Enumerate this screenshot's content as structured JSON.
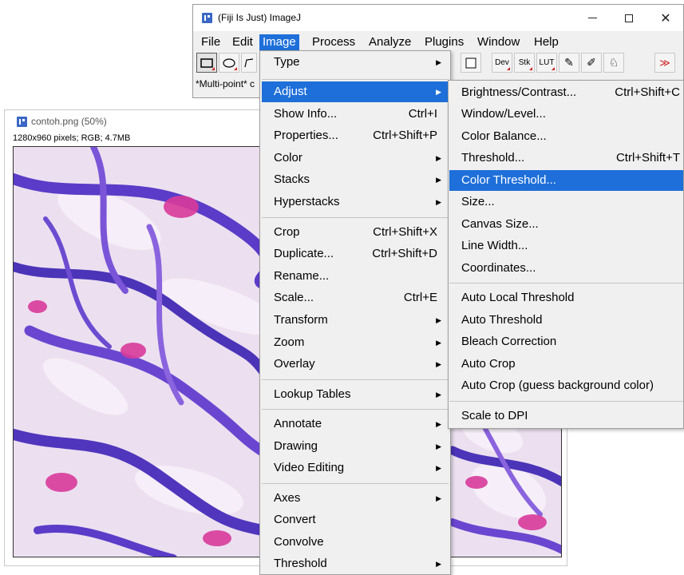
{
  "ij_window": {
    "title": "(Fiji Is Just) ImageJ",
    "controls": {
      "minimize": "minimize-icon",
      "maximize": "maximize-icon",
      "close": "✕"
    },
    "menubar": [
      "File",
      "Edit",
      "Image",
      "Process",
      "Analyze",
      "Plugins",
      "Window",
      "Help"
    ],
    "active_menu": "Image",
    "toolbar": [
      {
        "name": "rectangle-tool-icon",
        "label": ""
      },
      {
        "name": "oval-tool-icon",
        "label": ""
      },
      {
        "name": "polygon-tool-icon",
        "label": ""
      },
      {
        "name": "color-picker-tool-icon",
        "label": ""
      },
      {
        "name": "dev-tool-icon",
        "label": "Dev"
      },
      {
        "name": "stk-tool-icon",
        "label": "Stk"
      },
      {
        "name": "lut-tool-icon",
        "label": "LUT"
      },
      {
        "name": "pencil-tool-icon",
        "label": "✎"
      },
      {
        "name": "brush-tool-icon",
        "label": "✐"
      },
      {
        "name": "flood-fill-tool-icon",
        "label": "♘"
      },
      {
        "name": "more-tools-icon",
        "label": "≫"
      }
    ],
    "status": "*Multi-point* c"
  },
  "image_window": {
    "title": "contoh.png (50%)",
    "info": "1280x960 pixels; RGB; 4.7MB"
  },
  "image_menu": {
    "items": [
      {
        "label": "Type",
        "shortcut": "",
        "submenu": true
      },
      {
        "label": "Adjust",
        "shortcut": "",
        "submenu": true,
        "highlighted": true
      },
      {
        "label": "Show Info...",
        "shortcut": "Ctrl+I"
      },
      {
        "label": "Properties...",
        "shortcut": "Ctrl+Shift+P"
      },
      {
        "label": "Color",
        "shortcut": "",
        "submenu": true
      },
      {
        "label": "Stacks",
        "shortcut": "",
        "submenu": true
      },
      {
        "label": "Hyperstacks",
        "shortcut": "",
        "submenu": true
      },
      {
        "label": "Crop",
        "shortcut": "Ctrl+Shift+X"
      },
      {
        "label": "Duplicate...",
        "shortcut": "Ctrl+Shift+D"
      },
      {
        "label": "Rename...",
        "shortcut": ""
      },
      {
        "label": "Scale...",
        "shortcut": "Ctrl+E"
      },
      {
        "label": "Transform",
        "shortcut": "",
        "submenu": true
      },
      {
        "label": "Zoom",
        "shortcut": "",
        "submenu": true
      },
      {
        "label": "Overlay",
        "shortcut": "",
        "submenu": true
      },
      {
        "label": "Lookup Tables",
        "shortcut": "",
        "submenu": true
      },
      {
        "label": "Annotate",
        "shortcut": "",
        "submenu": true
      },
      {
        "label": "Drawing",
        "shortcut": "",
        "submenu": true
      },
      {
        "label": "Video Editing",
        "shortcut": "",
        "submenu": true
      },
      {
        "label": "Axes",
        "shortcut": "",
        "submenu": true
      },
      {
        "label": "Convert",
        "shortcut": ""
      },
      {
        "label": "Convolve",
        "shortcut": ""
      },
      {
        "label": "Threshold",
        "shortcut": "",
        "submenu": true
      }
    ]
  },
  "adjust_menu": {
    "items": [
      {
        "label": "Brightness/Contrast...",
        "shortcut": "Ctrl+Shift+C"
      },
      {
        "label": "Window/Level...",
        "shortcut": ""
      },
      {
        "label": "Color Balance...",
        "shortcut": ""
      },
      {
        "label": "Threshold...",
        "shortcut": "Ctrl+Shift+T"
      },
      {
        "label": "Color Threshold...",
        "shortcut": "",
        "highlighted": true
      },
      {
        "label": "Size...",
        "shortcut": ""
      },
      {
        "label": "Canvas Size...",
        "shortcut": ""
      },
      {
        "label": "Line Width...",
        "shortcut": ""
      },
      {
        "label": "Coordinates...",
        "shortcut": ""
      },
      {
        "label": "Auto Local Threshold",
        "shortcut": ""
      },
      {
        "label": "Auto Threshold",
        "shortcut": ""
      },
      {
        "label": "Bleach Correction",
        "shortcut": ""
      },
      {
        "label": "Auto Crop",
        "shortcut": ""
      },
      {
        "label": "Auto Crop (guess background color)",
        "shortcut": ""
      },
      {
        "label": "Scale to DPI",
        "shortcut": ""
      }
    ]
  },
  "colors": {
    "menu_highlight": "#1e6fd9",
    "menu_bg": "#f0f0f0",
    "app_icon": "#3b67c6"
  }
}
